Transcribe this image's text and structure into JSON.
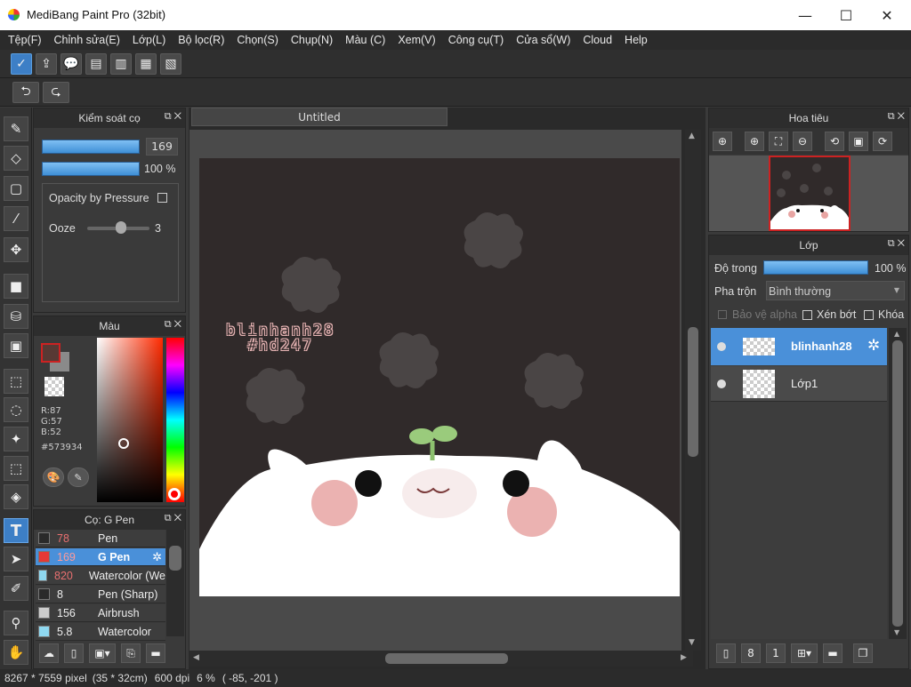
{
  "window": {
    "title": "MediBang Paint Pro (32bit)",
    "minimize": "—",
    "maximize": "☐",
    "close": "✕"
  },
  "menu": [
    "Tệp(F)",
    "Chỉnh sửa(E)",
    "Lớp(L)",
    "Bộ lọc(R)",
    "Chọn(S)",
    "Chụp(N)",
    "Màu (C)",
    "Xem(V)",
    "Công cụ(T)",
    "Cửa sổ(W)",
    "Cloud",
    "Help"
  ],
  "brush_control": {
    "title": "Kiểm soát cọ",
    "size_value": "169",
    "opacity_value": "100 %",
    "opacity_by_pressure": "Opacity by Pressure",
    "ooze_label": "Ooze",
    "ooze_value": "3"
  },
  "color_panel": {
    "title": "Màu",
    "r": "R:87",
    "g": "G:57",
    "b": "B:52",
    "hex": "#573934",
    "fg_color": "#573934",
    "bg_color": "#8a8a8a"
  },
  "brush_panel": {
    "title": "Cọ: G Pen",
    "items": [
      {
        "size": "78",
        "name": "Pen",
        "color": "#2a2a2a"
      },
      {
        "size": "169",
        "name": "G Pen",
        "color": "#e53935"
      },
      {
        "size": "820",
        "name": "Watercolor (We",
        "color": "#8fd8f0"
      },
      {
        "size": "8",
        "name": "Pen (Sharp)",
        "color": "#2a2a2a"
      },
      {
        "size": "156",
        "name": "Airbrush",
        "color": "#cccccc"
      },
      {
        "size": "5.8",
        "name": "Watercolor",
        "color": "#8fd8f0"
      }
    ]
  },
  "document": {
    "tab": "Untitled",
    "canvas_text_line1": "blinhanh28",
    "canvas_text_line2": "#hd247"
  },
  "navigator": {
    "title": "Hoa tiêu"
  },
  "layer_panel": {
    "title": "Lớp",
    "opacity_label": "Độ trong",
    "opacity_value": "100 %",
    "blend_label": "Pha trộn",
    "blend_value": "Bình thường",
    "protect_alpha": "Bảo vệ alpha",
    "clipping": "Xén bớt",
    "lock": "Khóa",
    "layers": [
      {
        "name": "blinhanh28"
      },
      {
        "name": "Lớp1"
      }
    ]
  },
  "status": {
    "size": "8267 * 7559 pixel",
    "cm": "(35 * 32cm)",
    "dpi": "600 dpi",
    "zoom": "6 %",
    "coords": "( -85, -201 )"
  }
}
